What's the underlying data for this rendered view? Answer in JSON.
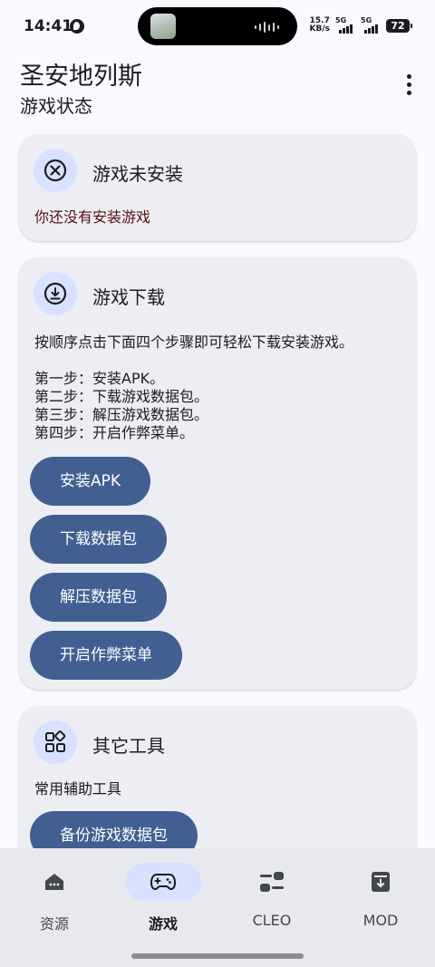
{
  "status_bar": {
    "time": "14:41",
    "net_speed_value": "15.7",
    "net_speed_unit": "KB/s",
    "sim1_label": "5G",
    "sim2_label": "5G",
    "battery": "72"
  },
  "header": {
    "title": "圣安地列斯",
    "subtitle": "游戏状态",
    "menu_icon": "more-vert-icon"
  },
  "cards": {
    "not_installed": {
      "icon": "cancel-circle-icon",
      "title": "游戏未安装",
      "message": "你还没有安装游戏",
      "message_color": "#5a0f0f"
    },
    "download": {
      "icon": "download-circle-icon",
      "title": "游戏下载",
      "intro": "按顺序点击下面四个步骤即可轻松下载安装游戏。",
      "steps": [
        "第一步：安装APK。",
        "第二步：下载游戏数据包。",
        "第三步：解压游戏数据包。",
        "第四步：开启作弊菜单。"
      ],
      "buttons": {
        "install_apk": "安装APK",
        "download_data": "下载数据包",
        "extract_data": "解压数据包",
        "enable_cheat_menu": "开启作弊菜单"
      }
    },
    "tools": {
      "icon": "widgets-icon",
      "title": "其它工具",
      "description": "常用辅助工具",
      "buttons": {
        "backup_data": "备份游戏数据包"
      }
    }
  },
  "bottom_nav": {
    "items": [
      {
        "label": "资源",
        "icon": "store-icon",
        "active": false
      },
      {
        "label": "游戏",
        "icon": "gamepad-icon",
        "active": true
      },
      {
        "label": "CLEO",
        "icon": "toggles-icon",
        "active": false
      },
      {
        "label": "MOD",
        "icon": "archive-download-icon",
        "active": false
      }
    ]
  },
  "colors": {
    "accent": "#415f91",
    "icon_container": "#d8e2ff",
    "card_background": "#eceef4",
    "page_background": "#f9f9ff",
    "nav_active_pill": "#d6e2fe"
  }
}
